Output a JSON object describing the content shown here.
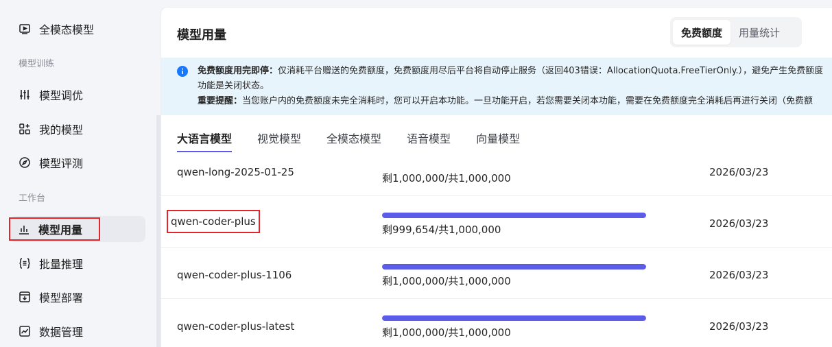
{
  "sidebar": {
    "items_top": [
      {
        "label": "全模态模型",
        "icon": "play-screen-icon"
      }
    ],
    "section_training": "模型训练",
    "items_training": [
      {
        "label": "模型调优",
        "icon": "sliders-icon"
      },
      {
        "label": "我的模型",
        "icon": "grid-plus-icon"
      },
      {
        "label": "模型评测",
        "icon": "compass-icon"
      }
    ],
    "section_workbench": "工作台",
    "items_workbench": [
      {
        "label": "模型用量",
        "icon": "bar-chart-icon",
        "active": true
      },
      {
        "label": "批量推理",
        "icon": "braces-list-icon"
      },
      {
        "label": "模型部署",
        "icon": "download-box-icon"
      },
      {
        "label": "数据管理",
        "icon": "line-chart-icon"
      }
    ]
  },
  "header": {
    "title": "模型用量",
    "segments": [
      "免费额度",
      "用量统计"
    ],
    "selected_segment": "免费额度"
  },
  "notice": {
    "line1_bold": "免费额度用完即停：",
    "line1_text": "仅消耗平台赠送的免费额度，免费额度用尽后平台将自动停止服务（返回403错误：AllocationQuota.FreeTierOnly.），避免产生免费额度",
    "line2_text": "功能是关闭状态。",
    "line3_bold": "重要提醒：",
    "line3_text": "当您账户内的免费额度未完全消耗时，您可以开启本功能。一旦功能开启，若您需要关闭本功能，需要在免费额度完全消耗后再进行关闭（免费额"
  },
  "tabs": [
    "大语言模型",
    "视觉模型",
    "全模态模型",
    "语音模型",
    "向量模型"
  ],
  "selected_tab": "大语言模型",
  "rows": [
    {
      "name": "qwen-long-2025-01-25",
      "quota": "剩1,000,000/共1,000,000",
      "remaining_fraction": 1.0,
      "date": "2026/03/23"
    },
    {
      "name": "qwen-coder-plus",
      "quota": "剩999,654/共1,000,000",
      "remaining_fraction": 0.99965,
      "date": "2026/03/23"
    },
    {
      "name": "qwen-coder-plus-1106",
      "quota": "剩1,000,000/共1,000,000",
      "remaining_fraction": 1.0,
      "date": "2026/03/23"
    },
    {
      "name": "qwen-coder-plus-latest",
      "quota": "剩1,000,000/共1,000,000",
      "remaining_fraction": 1.0,
      "date": "2026/03/23"
    }
  ],
  "colors": {
    "accent": "#5b5ce8",
    "highlight_box": "#e0262b",
    "notice_bg": "#e8f4fc",
    "info": "#1677ff"
  }
}
